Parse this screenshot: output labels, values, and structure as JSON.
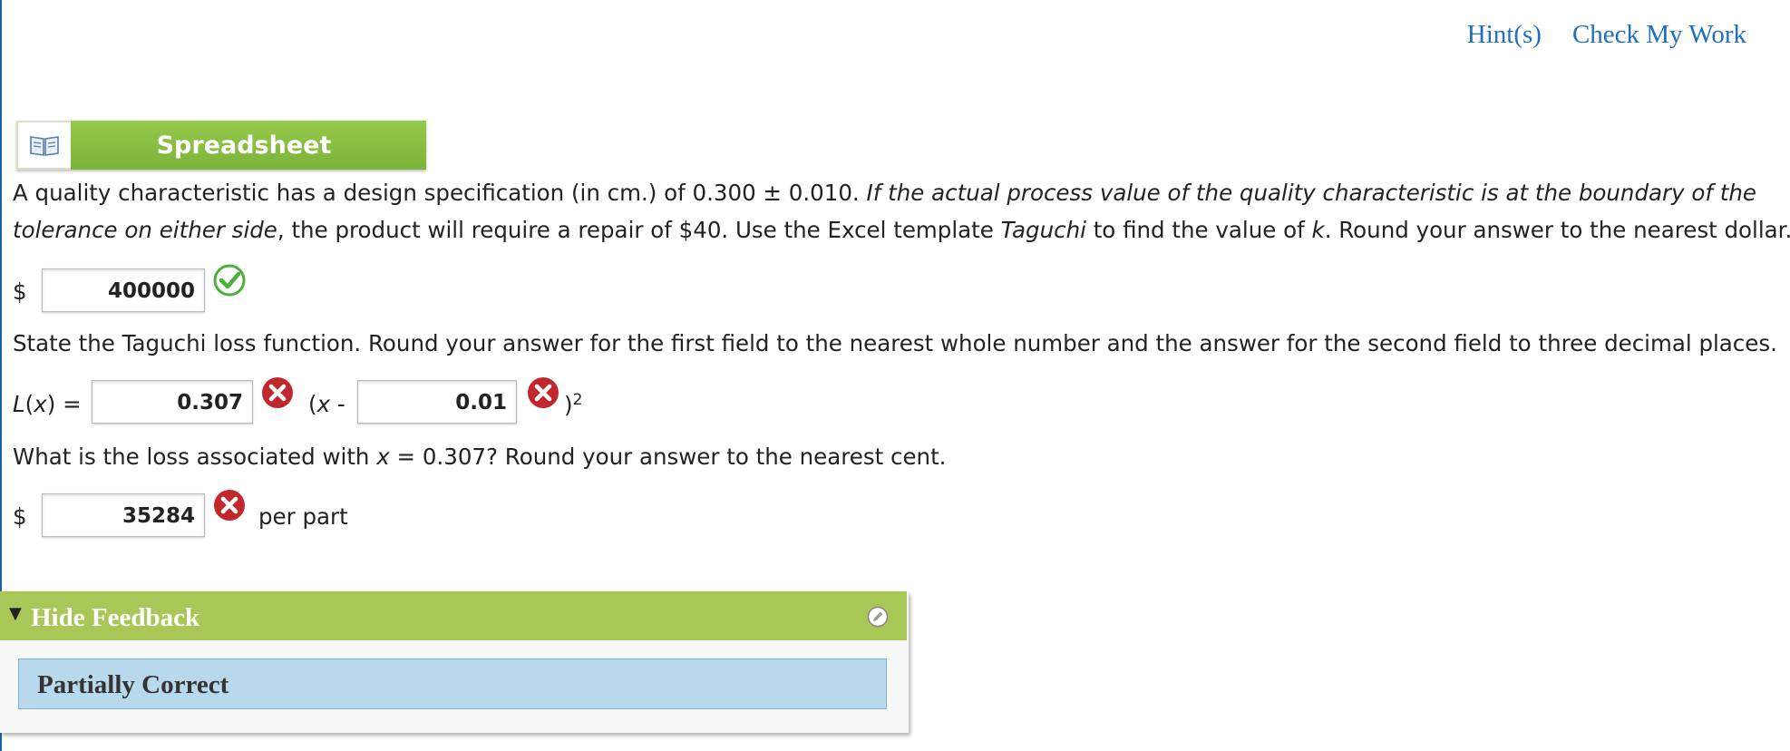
{
  "header": {
    "links": [
      {
        "label": "Hint(s)"
      },
      {
        "label": "Check My Work"
      }
    ]
  },
  "spreadsheet_button": {
    "label": "Spreadsheet",
    "icon": "book-icon"
  },
  "question1": {
    "part1": "A quality characteristic has a design specification (in cm.) of 0.300 ± 0.010. ",
    "italic1": "If the actual process value of the quality characteristic is at the boundary of the",
    "italic2": "tolerance on either side",
    "part2": ", the product will require a repair of $40. Use the Excel template ",
    "italic_template": "Taguchi",
    "part3": " to find the value of ",
    "italic_k": "k",
    "part4": ". Round your answer to the nearest dollar."
  },
  "answer1": {
    "currency": "$",
    "value": "400000",
    "status": "correct"
  },
  "question2": {
    "text": "State the Taguchi loss function. Round your answer for the first field to the nearest whole number and the answer for the second field to three decimal places."
  },
  "answer2": {
    "lhs_italic": "L",
    "lhs_paren_open": "(",
    "lhs_var": "x",
    "lhs_rest": ") =",
    "field1_value": "0.307",
    "field1_status": "incorrect",
    "mid_open": "(",
    "mid_var": "x",
    "mid_minus": " -",
    "field2_value": "0.01",
    "field2_status": "incorrect",
    "close": ")",
    "exponent": "2"
  },
  "question3": {
    "part1": "What is the loss associated with ",
    "var": "x",
    "part2": " = 0.307? Round your answer to the nearest cent."
  },
  "answer3": {
    "currency": "$",
    "value": "35284",
    "status": "incorrect",
    "suffix": "per part"
  },
  "feedback": {
    "toggle_label": "Hide Feedback",
    "status": "Partially Correct"
  },
  "colors": {
    "link": "#1f6fbf",
    "green": "#a8c756",
    "feedback_body": "#b8d9ec",
    "error_red": "#c0282d",
    "correct_green": "#4caf3a"
  }
}
